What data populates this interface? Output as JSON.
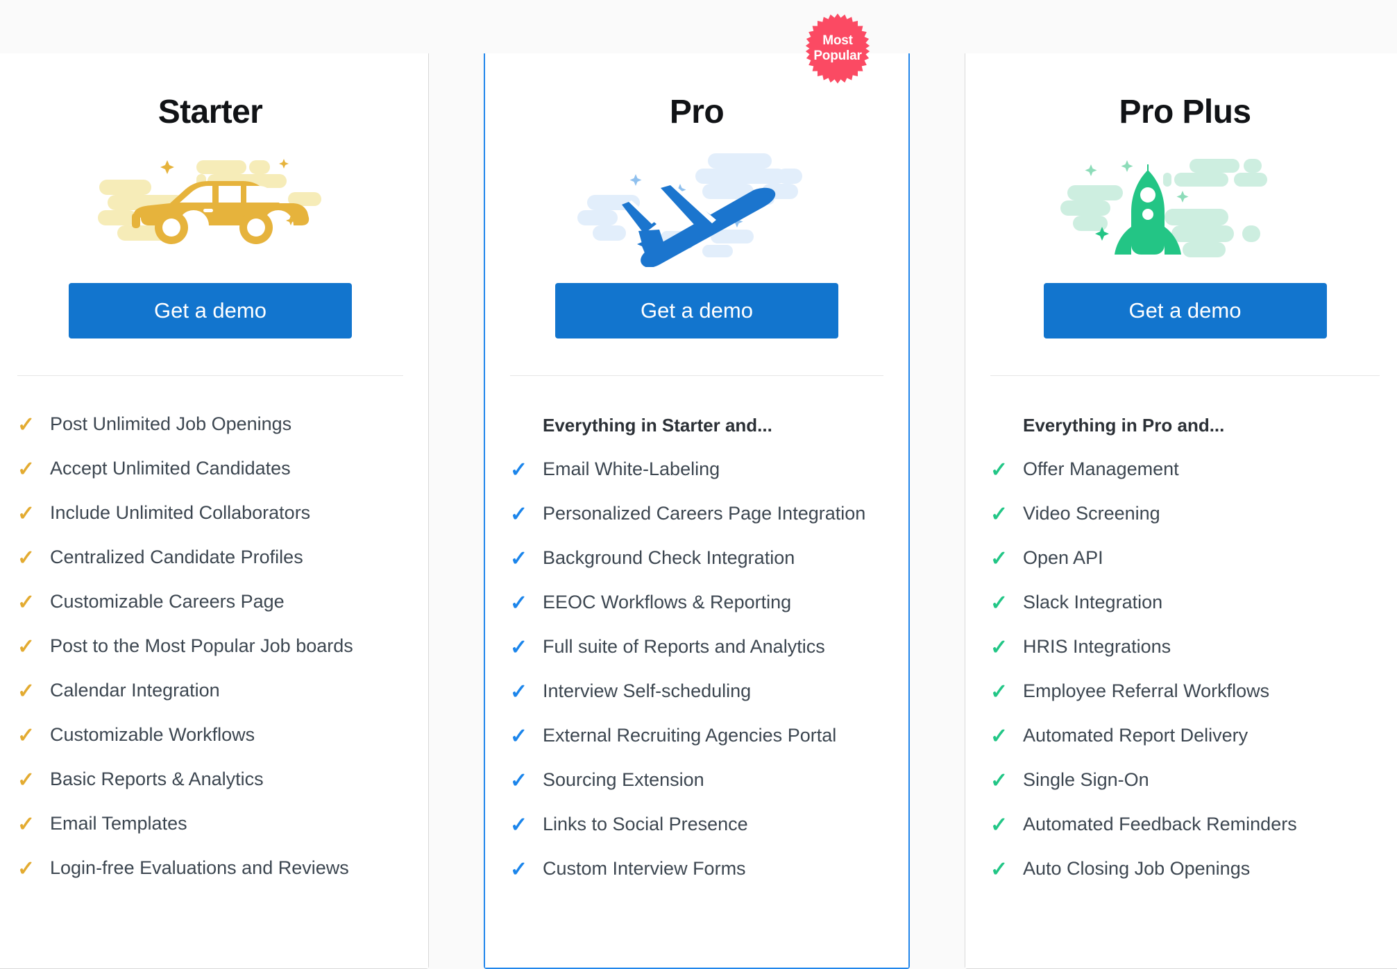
{
  "colors": {
    "page_background": "#fafafa",
    "cta_blue": "#1275CE",
    "pro_border_blue": "#2186EB",
    "starter_accent": "#faf3c8",
    "pro_accent": "#e3f0fd",
    "proplus_accent": "#cfeee0",
    "starter_check": "#e3ab31",
    "pro_check": "#1b85eb",
    "proplus_check": "#22c686",
    "badge_pink": "#FB4A63",
    "car_gold": "#e6b33c",
    "plane_blue": "#1b75ce",
    "rocket_green": "#23c585"
  },
  "badge": {
    "line1": "Most",
    "line2": "Popular",
    "icon": "starburst-badge-icon"
  },
  "plans": [
    {
      "id": "starter",
      "title": "Starter",
      "illustration_icon": "car-illustration-icon",
      "cta_label": "Get a demo",
      "feature_heading": null,
      "features": [
        "Post Unlimited Job Openings",
        "Accept Unlimited Candidates",
        "Include Unlimited Collaborators",
        "Centralized Candidate Profiles",
        "Customizable Careers Page",
        "Post to the Most Popular Job boards",
        "Calendar Integration",
        "Customizable Workflows",
        "Basic Reports & Analytics",
        "Email Templates",
        "Login-free Evaluations and Reviews"
      ]
    },
    {
      "id": "pro",
      "title": "Pro",
      "illustration_icon": "airplane-illustration-icon",
      "cta_label": "Get a demo",
      "feature_heading": "Everything in Starter and...",
      "features": [
        "Email White-Labeling",
        "Personalized Careers Page Integration",
        "Background Check Integration",
        "EEOC Workflows & Reporting",
        "Full suite of Reports and Analytics",
        "Interview Self-scheduling",
        "External Recruiting Agencies Portal",
        "Sourcing Extension",
        "Links to Social Presence",
        "Custom Interview Forms"
      ]
    },
    {
      "id": "proplus",
      "title": "Pro Plus",
      "illustration_icon": "rocket-illustration-icon",
      "cta_label": "Get a demo",
      "feature_heading": "Everything in Pro and...",
      "features": [
        "Offer Management",
        "Video Screening",
        "Open API",
        "Slack Integration",
        "HRIS Integrations",
        "Employee Referral Workflows",
        "Automated Report Delivery",
        "Single Sign-On",
        "Automated Feedback Reminders",
        "Auto Closing Job Openings"
      ]
    }
  ]
}
